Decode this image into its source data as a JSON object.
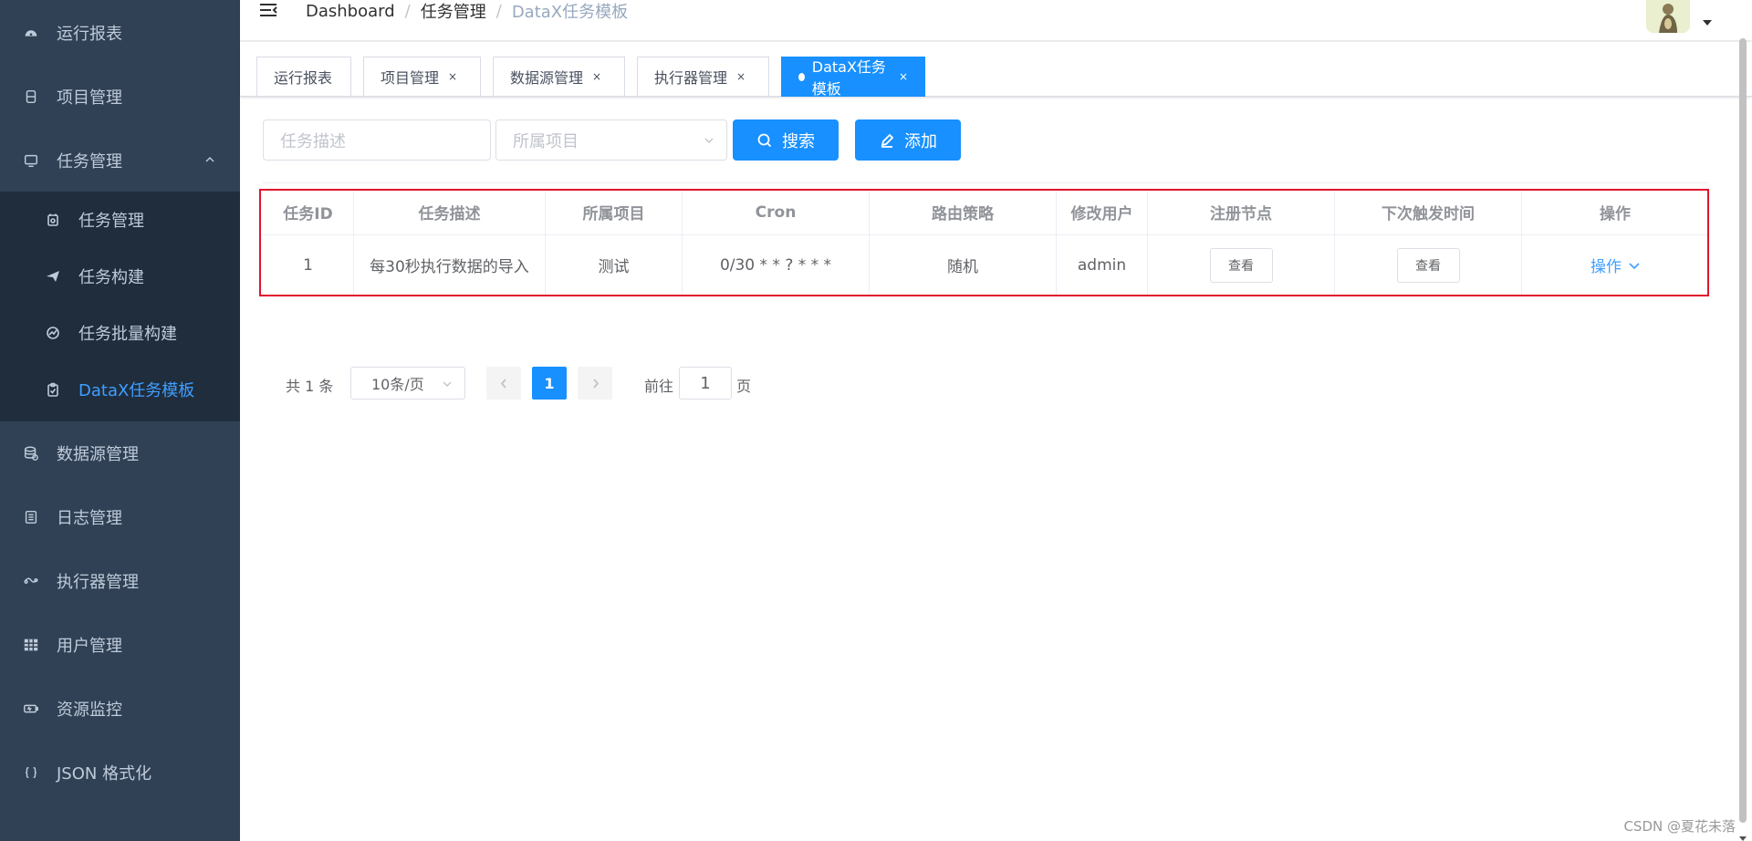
{
  "sidebar": {
    "items": [
      {
        "label": "运行报表",
        "icon": "dashboard-icon"
      },
      {
        "label": "项目管理",
        "icon": "project-icon"
      },
      {
        "label": "任务管理",
        "icon": "monitor-icon"
      },
      {
        "label": "数据源管理",
        "icon": "database-icon"
      },
      {
        "label": "日志管理",
        "icon": "log-icon"
      },
      {
        "label": "执行器管理",
        "icon": "executor-icon"
      },
      {
        "label": "用户管理",
        "icon": "table-icon"
      },
      {
        "label": "资源监控",
        "icon": "battery-icon"
      },
      {
        "label": "JSON 格式化",
        "icon": "braces-icon"
      }
    ],
    "submenu": [
      {
        "label": "任务管理",
        "icon": "calendar-icon"
      },
      {
        "label": "任务构建",
        "icon": "send-icon"
      },
      {
        "label": "任务批量构建",
        "icon": "chart-icon"
      },
      {
        "label": "DataX任务模板",
        "icon": "clipboard-icon"
      }
    ]
  },
  "breadcrumb": [
    "Dashboard",
    "任务管理",
    "DataX任务模板"
  ],
  "tags": [
    {
      "label": "运行报表",
      "closable": false
    },
    {
      "label": "项目管理",
      "closable": true
    },
    {
      "label": "数据源管理",
      "closable": true
    },
    {
      "label": "执行器管理",
      "closable": true
    },
    {
      "label": "DataX任务模板",
      "closable": true,
      "active": true
    }
  ],
  "tag_close": "×",
  "filters": {
    "desc_placeholder": "任务描述",
    "project_placeholder": "所属项目",
    "search_label": "搜索",
    "add_label": "添加"
  },
  "table": {
    "headers": [
      "任务ID",
      "任务描述",
      "所属项目",
      "Cron",
      "路由策略",
      "修改用户",
      "注册节点",
      "下次触发时间",
      "操作"
    ],
    "rows": [
      {
        "id": "1",
        "desc": "每30秒执行数据的导入",
        "project": "测试",
        "cron": "0/30 * * ? * * *",
        "route": "随机",
        "user": "admin",
        "nodes_btn": "查看",
        "next_btn": "查看",
        "op": "操作"
      }
    ]
  },
  "pagination": {
    "total": "共 1 条",
    "page_size": "10条/页",
    "current": "1",
    "goto": "前往",
    "goto_value": "1",
    "page_suffix": "页"
  },
  "watermark": "CSDN @夏花未落",
  "colors": {
    "sidebar_bg": "#304156",
    "submenu_bg": "#1f2d3d",
    "primary": "#1890ff",
    "active_text": "#409eff",
    "highlight_border": "#e0142e"
  }
}
